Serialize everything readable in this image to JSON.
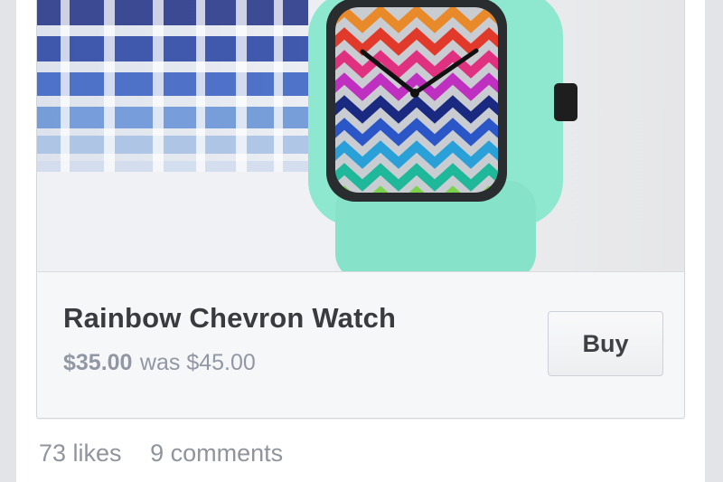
{
  "product": {
    "image_subject": "watch-photo",
    "title": "Rainbow Chevron Watch",
    "price": "$35.00",
    "was_price": "was $45.00",
    "buy_label": "Buy"
  },
  "stats": {
    "likes": "73 likes",
    "comments": "9 comments"
  },
  "colors": {
    "strap": "#8ee8cf",
    "title_text": "#3a3b3e",
    "muted_text": "#9197a3"
  }
}
